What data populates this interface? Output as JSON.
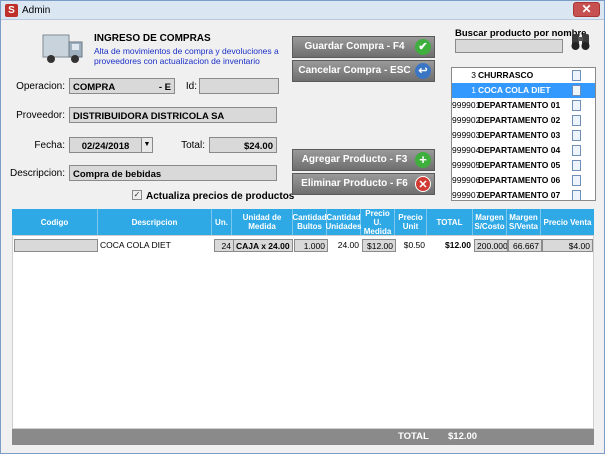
{
  "window": {
    "title": "Admin",
    "app_icon_letter": "S",
    "close_symbol": "✕"
  },
  "header": {
    "title": "INGRESO DE COMPRAS",
    "subtitle": "Alta de movimientos de compra y devoluciones a proveedores con actualizacion de inventario"
  },
  "form": {
    "operacion_label": "Operacion:",
    "operacion_value": "COMPRA",
    "operacion_suffix": "- E",
    "id_label": "Id:",
    "id_value": "",
    "proveedor_label": "Proveedor:",
    "proveedor_value": "DISTRIBUIDORA DISTRICOLA  SA",
    "fecha_label": "Fecha:",
    "fecha_value": "02/24/2018",
    "total_label": "Total:",
    "total_value": "$24.00",
    "descripcion_label": "Descripcion:",
    "descripcion_value": "Compra de bebidas",
    "actualiza_label": "Actualiza precios de productos",
    "actualiza_checked": true
  },
  "buttons": {
    "guardar": "Guardar Compra - F4",
    "cancelar": "Cancelar Compra - ESC",
    "agregar": "Agregar Producto - F3",
    "eliminar": "Eliminar Producto - F6"
  },
  "search": {
    "label": "Buscar producto por nombre",
    "value": ""
  },
  "product_list": [
    {
      "code": "3",
      "name": "CHURRASCO",
      "selected": false
    },
    {
      "code": "1",
      "name": "COCA COLA DIET",
      "selected": true
    },
    {
      "code": "999901",
      "name": "DEPARTAMENTO 01",
      "selected": false
    },
    {
      "code": "999902",
      "name": "DEPARTAMENTO 02",
      "selected": false
    },
    {
      "code": "999903",
      "name": "DEPARTAMENTO 03",
      "selected": false
    },
    {
      "code": "999904",
      "name": "DEPARTAMENTO 04",
      "selected": false
    },
    {
      "code": "999905",
      "name": "DEPARTAMENTO 05",
      "selected": false
    },
    {
      "code": "999906",
      "name": "DEPARTAMENTO 06",
      "selected": false
    },
    {
      "code": "999907",
      "name": "DEPARTAMENTO 07",
      "selected": false
    }
  ],
  "grid": {
    "columns": [
      "Codigo",
      "Descripcion",
      "Un.",
      "Unidad de Medida",
      "Cantidad Bultos",
      "Cantidad Unidades",
      "Precio U. Medida",
      "Precio Unit",
      "TOTAL",
      "Margen S/Costo",
      "Margen S/Venta",
      "Precio Venta"
    ],
    "rows": [
      {
        "codigo": "",
        "descripcion": "COCA COLA DIET",
        "un": "24",
        "unidad_medida": "CAJA x 24.00",
        "bultos": "1.000",
        "unidades": "24.00",
        "precio_um": "$12.00",
        "precio_unit": "$0.50",
        "total": "$12.00",
        "margen_costo": "200.000",
        "margen_venta": "66.667",
        "precio_venta": "$4.00"
      }
    ]
  },
  "footer": {
    "total_label": "TOTAL",
    "total_value": "$12.00"
  },
  "colors": {
    "grid_header": "#2fa8e6",
    "selection": "#3399ff",
    "subtitle": "#1b2fc7"
  }
}
